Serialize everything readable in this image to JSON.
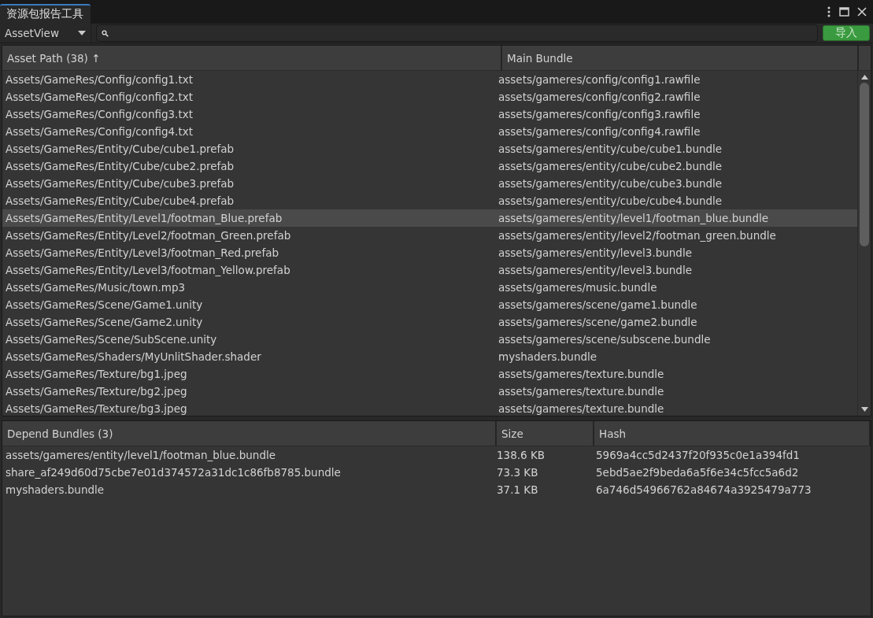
{
  "window": {
    "tab_title": "资源包报告工具"
  },
  "toolbar": {
    "view_dropdown": "AssetView",
    "import_button": "导入"
  },
  "asset_table": {
    "columns": [
      "Asset Path (38) ↑",
      "Main Bundle"
    ],
    "rows": [
      {
        "asset_path": "Assets/GameRes/Config/config1.txt",
        "main_bundle": "assets/gameres/config/config1.rawfile",
        "selected": false
      },
      {
        "asset_path": "Assets/GameRes/Config/config2.txt",
        "main_bundle": "assets/gameres/config/config2.rawfile",
        "selected": false
      },
      {
        "asset_path": "Assets/GameRes/Config/config3.txt",
        "main_bundle": "assets/gameres/config/config3.rawfile",
        "selected": false
      },
      {
        "asset_path": "Assets/GameRes/Config/config4.txt",
        "main_bundle": "assets/gameres/config/config4.rawfile",
        "selected": false
      },
      {
        "asset_path": "Assets/GameRes/Entity/Cube/cube1.prefab",
        "main_bundle": "assets/gameres/entity/cube/cube1.bundle",
        "selected": false
      },
      {
        "asset_path": "Assets/GameRes/Entity/Cube/cube2.prefab",
        "main_bundle": "assets/gameres/entity/cube/cube2.bundle",
        "selected": false
      },
      {
        "asset_path": "Assets/GameRes/Entity/Cube/cube3.prefab",
        "main_bundle": "assets/gameres/entity/cube/cube3.bundle",
        "selected": false
      },
      {
        "asset_path": "Assets/GameRes/Entity/Cube/cube4.prefab",
        "main_bundle": "assets/gameres/entity/cube/cube4.bundle",
        "selected": false
      },
      {
        "asset_path": "Assets/GameRes/Entity/Level1/footman_Blue.prefab",
        "main_bundle": "assets/gameres/entity/level1/footman_blue.bundle",
        "selected": true
      },
      {
        "asset_path": "Assets/GameRes/Entity/Level2/footman_Green.prefab",
        "main_bundle": "assets/gameres/entity/level2/footman_green.bundle",
        "selected": false
      },
      {
        "asset_path": "Assets/GameRes/Entity/Level3/footman_Red.prefab",
        "main_bundle": "assets/gameres/entity/level3.bundle",
        "selected": false
      },
      {
        "asset_path": "Assets/GameRes/Entity/Level3/footman_Yellow.prefab",
        "main_bundle": "assets/gameres/entity/level3.bundle",
        "selected": false
      },
      {
        "asset_path": "Assets/GameRes/Music/town.mp3",
        "main_bundle": "assets/gameres/music.bundle",
        "selected": false
      },
      {
        "asset_path": "Assets/GameRes/Scene/Game1.unity",
        "main_bundle": "assets/gameres/scene/game1.bundle",
        "selected": false
      },
      {
        "asset_path": "Assets/GameRes/Scene/Game2.unity",
        "main_bundle": "assets/gameres/scene/game2.bundle",
        "selected": false
      },
      {
        "asset_path": "Assets/GameRes/Scene/SubScene.unity",
        "main_bundle": "assets/gameres/scene/subscene.bundle",
        "selected": false
      },
      {
        "asset_path": "Assets/GameRes/Shaders/MyUnlitShader.shader",
        "main_bundle": "myshaders.bundle",
        "selected": false
      },
      {
        "asset_path": "Assets/GameRes/Texture/bg1.jpeg",
        "main_bundle": "assets/gameres/texture.bundle",
        "selected": false
      },
      {
        "asset_path": "Assets/GameRes/Texture/bg2.jpeg",
        "main_bundle": "assets/gameres/texture.bundle",
        "selected": false
      },
      {
        "asset_path": "Assets/GameRes/Texture/bg3.jpeg",
        "main_bundle": "assets/gameres/texture.bundle",
        "selected": false
      }
    ]
  },
  "depend_table": {
    "columns": [
      "Depend Bundles (3)",
      "Size",
      "Hash"
    ],
    "rows": [
      {
        "bundle": "assets/gameres/entity/level1/footman_blue.bundle",
        "size": "138.6 KB",
        "hash": "5969a4cc5d2437f20f935c0e1a394fd1"
      },
      {
        "bundle": "share_af249d60d75cbe7e01d374572a31dc1c86fb8785.bundle",
        "size": "73.3 KB",
        "hash": "5ebd5ae2f9beda6a5f6e34c5fcc5a6d2"
      },
      {
        "bundle": "myshaders.bundle",
        "size": "37.1 KB",
        "hash": "6a746d54966762a84674a3925479a773"
      }
    ]
  }
}
